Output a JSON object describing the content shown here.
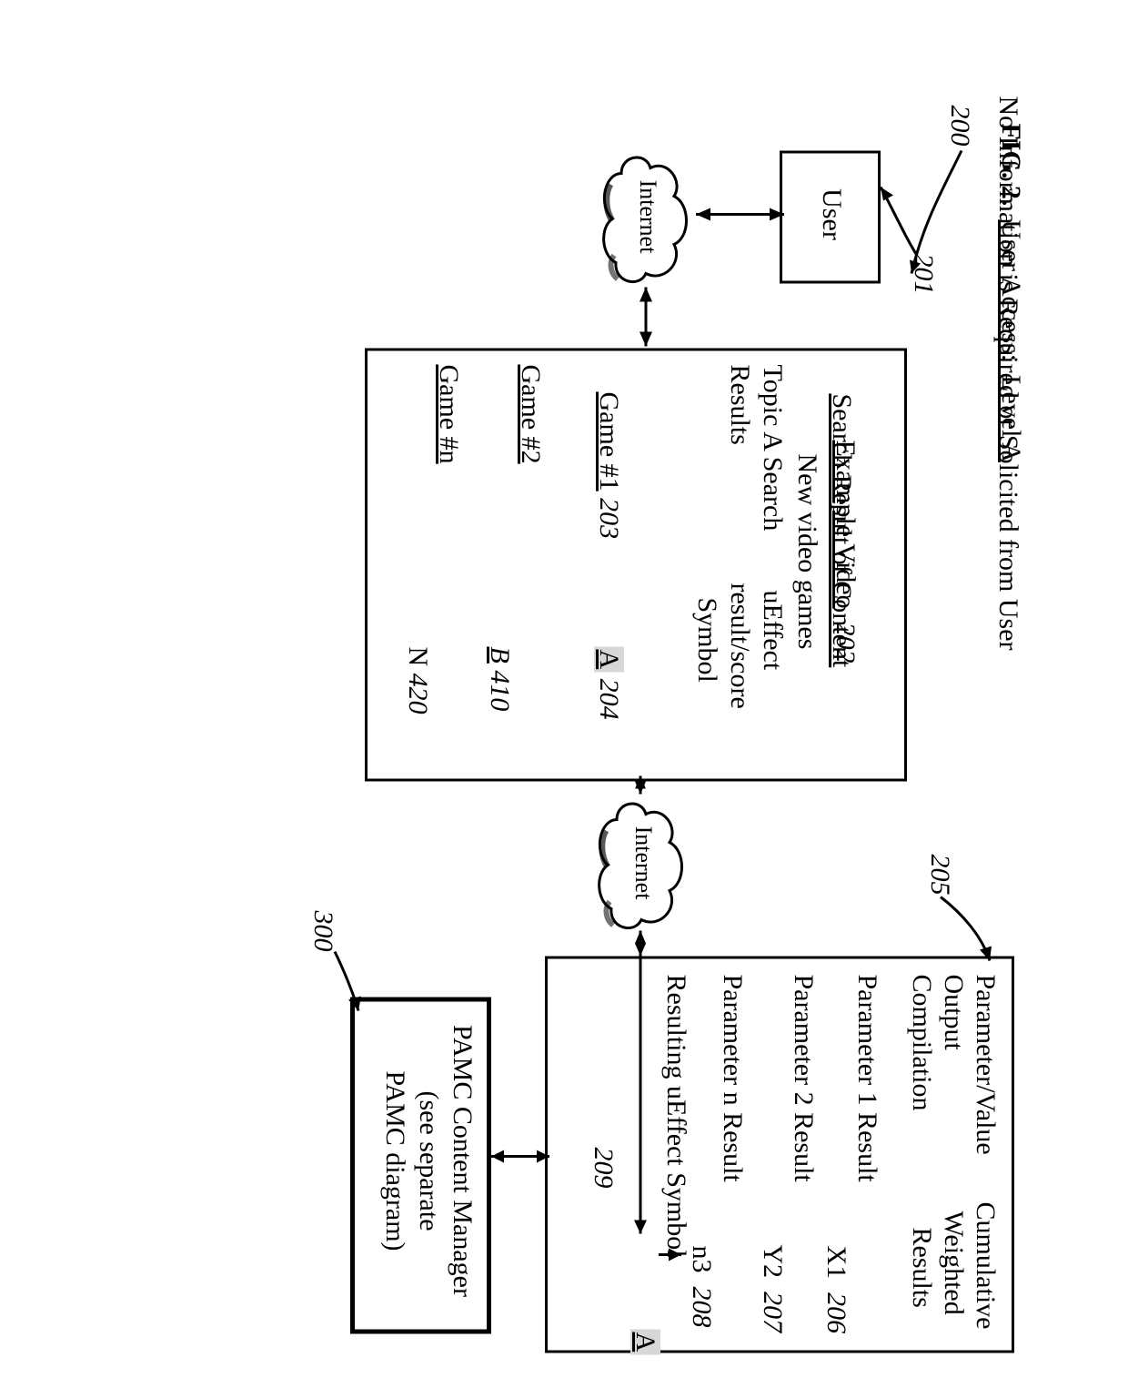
{
  "header": {
    "fig_prefix": "FIG. 2.",
    "title": "User Access:  Level A",
    "subtitle": "No Information is Required or Solicited from User"
  },
  "refs": {
    "r200": "200",
    "r201": "201",
    "r205": "205",
    "r300": "300"
  },
  "user_box": {
    "label": "User"
  },
  "clouds": {
    "internet1": "Internet",
    "internet2": "Internet"
  },
  "search_box": {
    "example_video": "Example Video",
    "ref202": "202",
    "search_result_heading": "Search Result of Content",
    "topic_line": "New video games",
    "topic_a_label": "Topic A Search",
    "results_label": "Results",
    "ueffect_col1": "uEffect",
    "ueffect_col2": "result/score",
    "ueffect_col3": "Symbol",
    "row1": {
      "name": "Game #1",
      "ref": "203",
      "val": "A",
      "vref": "204"
    },
    "row2": {
      "name": "Game #2",
      "val": "B",
      "vref": "410"
    },
    "row3": {
      "name": "Game #n",
      "val": "N",
      "vref": "420"
    }
  },
  "param_box": {
    "h_left1": "Parameter/Value",
    "h_left2": "Output",
    "h_left3": "Compilation",
    "h_right1": "Cumulative",
    "h_right2": "Weighted",
    "h_right3": "Results",
    "rows": {
      "r1": {
        "l": "Parameter 1 Result",
        "v": "X1",
        "ref": "206"
      },
      "r2": {
        "l": "Parameter 2 Result",
        "v": "Y2",
        "ref": "207"
      },
      "r3": {
        "l": "Parameter n Result",
        "v": "n3",
        "ref": "208"
      }
    },
    "result_label": "Resulting uEffect Symbol",
    "result_val": "A",
    "ref209": "209"
  },
  "pamc": {
    "l1": "PAMC Content Manager",
    "l2": "(see separate",
    "l3": "PAMC diagram)"
  }
}
